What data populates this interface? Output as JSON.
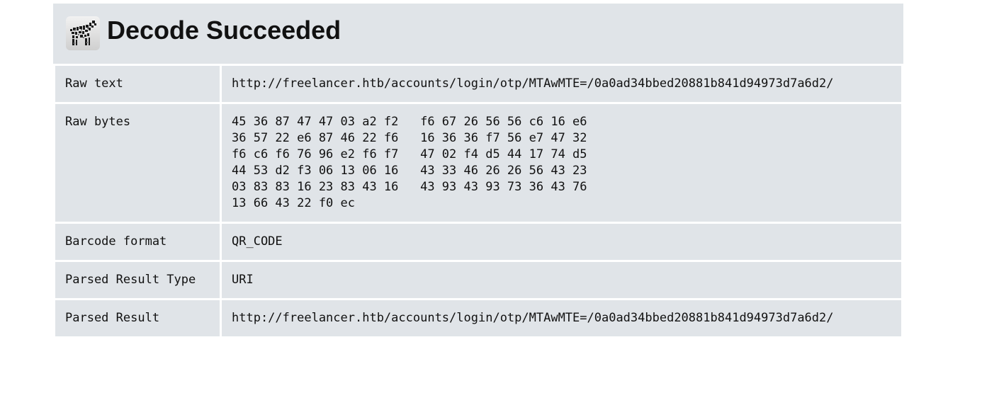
{
  "header": {
    "title": "Decode Succeeded",
    "logo_icon": "zxing-zebra-logo-icon"
  },
  "rows": [
    {
      "label": "Raw text",
      "value": "http://freelancer.htb/accounts/login/otp/MTAwMTE=/0a0ad34bbed20881b841d94973d7a6d2/"
    },
    {
      "label": "Raw bytes",
      "value": "45 36 87 47 47 03 a2 f2   f6 67 26 56 56 c6 16 e6\n36 57 22 e6 87 46 22 f6   16 36 36 f7 56 e7 47 32\nf6 c6 f6 76 96 e2 f6 f7   47 02 f4 d5 44 17 74 d5\n44 53 d2 f3 06 13 06 16   43 33 46 26 26 56 43 23\n03 83 83 16 23 83 43 16   43 93 43 93 73 36 43 76\n13 66 43 22 f0 ec"
    },
    {
      "label": "Barcode format",
      "value": "QR_CODE"
    },
    {
      "label": "Parsed Result Type",
      "value": "URI"
    },
    {
      "label": "Parsed Result",
      "value": "http://freelancer.htb/accounts/login/otp/MTAwMTE=/0a0ad34bbed20881b841d94973d7a6d2/"
    }
  ]
}
